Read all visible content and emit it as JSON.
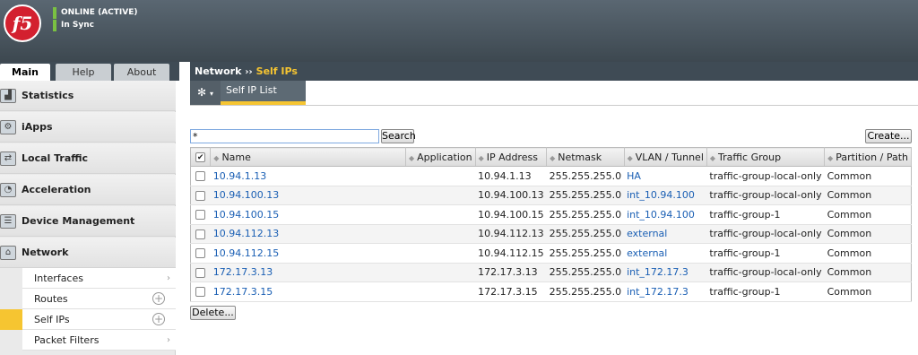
{
  "header": {
    "logo_text": "f5",
    "status": "ONLINE (ACTIVE)",
    "sync": "In Sync",
    "status_color": "#7ac142"
  },
  "tabs": [
    {
      "label": "Main",
      "active": true
    },
    {
      "label": "Help",
      "active": false
    },
    {
      "label": "About",
      "active": false
    }
  ],
  "breadcrumb": {
    "section": "Network",
    "separator": "››",
    "current": "Self IPs"
  },
  "nav": [
    {
      "label": "Statistics",
      "icon": "statistics-icon"
    },
    {
      "label": "iApps",
      "icon": "iapps-icon"
    },
    {
      "label": "Local Traffic",
      "icon": "local-traffic-icon"
    },
    {
      "label": "Acceleration",
      "icon": "acceleration-icon"
    },
    {
      "label": "Device Management",
      "icon": "device-management-icon"
    },
    {
      "label": "Network",
      "icon": "network-icon"
    }
  ],
  "subnav": [
    {
      "label": "Interfaces",
      "control": "arrow"
    },
    {
      "label": "Routes",
      "control": "plus"
    },
    {
      "label": "Self IPs",
      "control": "plus",
      "active": true
    },
    {
      "label": "Packet Filters",
      "control": "arrow"
    }
  ],
  "toolbar": {
    "gear_icon": "gear-icon",
    "subtab_label": "Self IP List",
    "accent": "#f6c531"
  },
  "search": {
    "value": "*",
    "button": "Search"
  },
  "actions": {
    "create": "Create...",
    "delete": "Delete..."
  },
  "table": {
    "columns": [
      "Name",
      "Application",
      "IP Address",
      "Netmask",
      "VLAN / Tunnel",
      "Traffic Group",
      "Partition / Path"
    ],
    "rows": [
      {
        "name": "10.94.1.13",
        "application": "",
        "ip": "10.94.1.13",
        "netmask": "255.255.255.0",
        "vlan": "HA",
        "traffic_group": "traffic-group-local-only",
        "partition": "Common"
      },
      {
        "name": "10.94.100.13",
        "application": "",
        "ip": "10.94.100.13",
        "netmask": "255.255.255.0",
        "vlan": "int_10.94.100",
        "traffic_group": "traffic-group-local-only",
        "partition": "Common"
      },
      {
        "name": "10.94.100.15",
        "application": "",
        "ip": "10.94.100.15",
        "netmask": "255.255.255.0",
        "vlan": "int_10.94.100",
        "traffic_group": "traffic-group-1",
        "partition": "Common"
      },
      {
        "name": "10.94.112.13",
        "application": "",
        "ip": "10.94.112.13",
        "netmask": "255.255.255.0",
        "vlan": "external",
        "traffic_group": "traffic-group-local-only",
        "partition": "Common"
      },
      {
        "name": "10.94.112.15",
        "application": "",
        "ip": "10.94.112.15",
        "netmask": "255.255.255.0",
        "vlan": "external",
        "traffic_group": "traffic-group-1",
        "partition": "Common"
      },
      {
        "name": "172.17.3.13",
        "application": "",
        "ip": "172.17.3.13",
        "netmask": "255.255.255.0",
        "vlan": "int_172.17.3",
        "traffic_group": "traffic-group-local-only",
        "partition": "Common"
      },
      {
        "name": "172.17.3.15",
        "application": "",
        "ip": "172.17.3.15",
        "netmask": "255.255.255.0",
        "vlan": "int_172.17.3",
        "traffic_group": "traffic-group-1",
        "partition": "Common"
      }
    ]
  }
}
